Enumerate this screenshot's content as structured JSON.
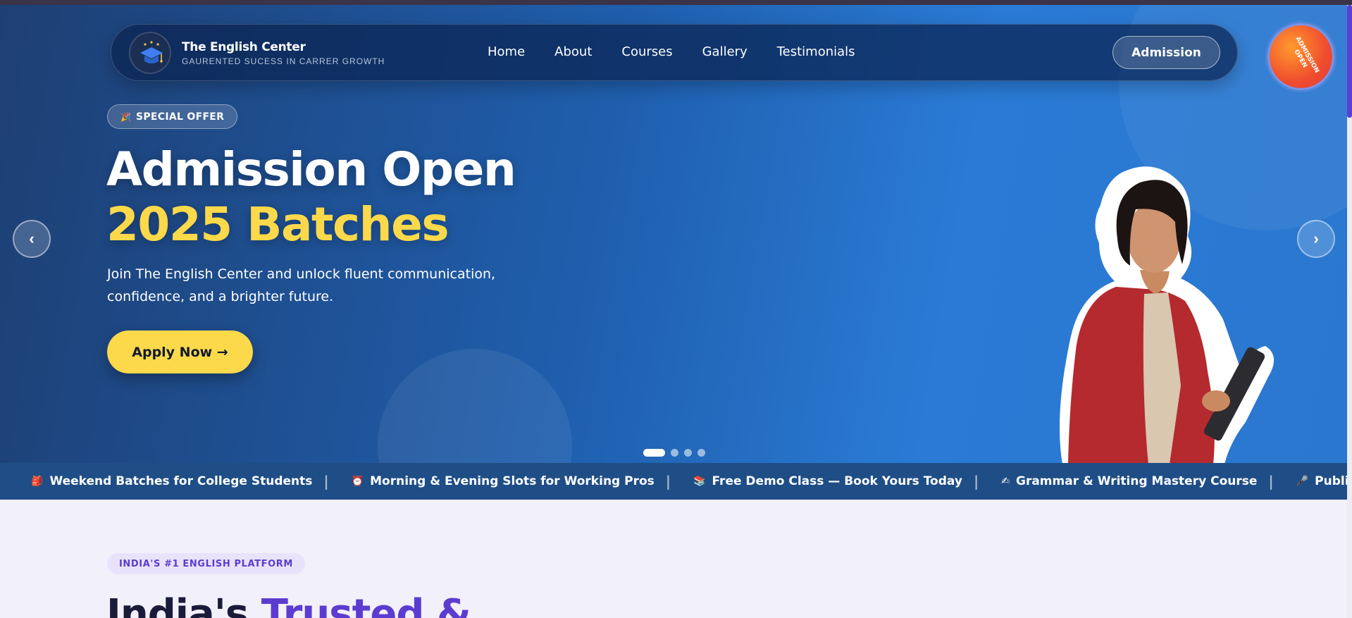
{
  "header": {
    "brand_name": "The English Center",
    "brand_tagline": "GAURENTED SUCESS IN CARRER GROWTH",
    "logo_icon": "graduation-cap-icon",
    "nav": [
      "Home",
      "About",
      "Courses",
      "Gallery",
      "Testimonials"
    ],
    "admission_label": "Admission"
  },
  "badge": {
    "text": "ADMISSION OPEN"
  },
  "hero": {
    "offer_icon": "party-popper-icon",
    "offer_label": "SPECIAL OFFER",
    "headline_line1": "Admission Open",
    "headline_line2": "2025 Batches",
    "description": "Join The English Center and unlock fluent communication, confidence, and a brighter future.",
    "cta_label": "Apply Now →",
    "prev_label": "‹",
    "next_label": "›",
    "slide_count": 4,
    "active_slide": 1
  },
  "ticker": [
    {
      "icon": "🎒",
      "text": "Weekend Batches for College Students"
    },
    {
      "icon": "⏰",
      "text": "Morning & Evening Slots for Working Pros"
    },
    {
      "icon": "📚",
      "text": "Free Demo Class — Book Yours Today"
    },
    {
      "icon": "✍",
      "text": "Grammar & Writing Mastery Course"
    },
    {
      "icon": "🎤",
      "text": "Public Speaking &"
    }
  ],
  "section": {
    "eyebrow": "INDIA'S #1 ENGLISH PLATFORM",
    "title_dark": "India's ",
    "title_accent": "Trusted &"
  },
  "colors": {
    "accent_yellow": "#fbd94a",
    "accent_purple": "#5b3cd1",
    "hero_blue": "#1f5fae",
    "badge_orange": "#f04d2e"
  }
}
